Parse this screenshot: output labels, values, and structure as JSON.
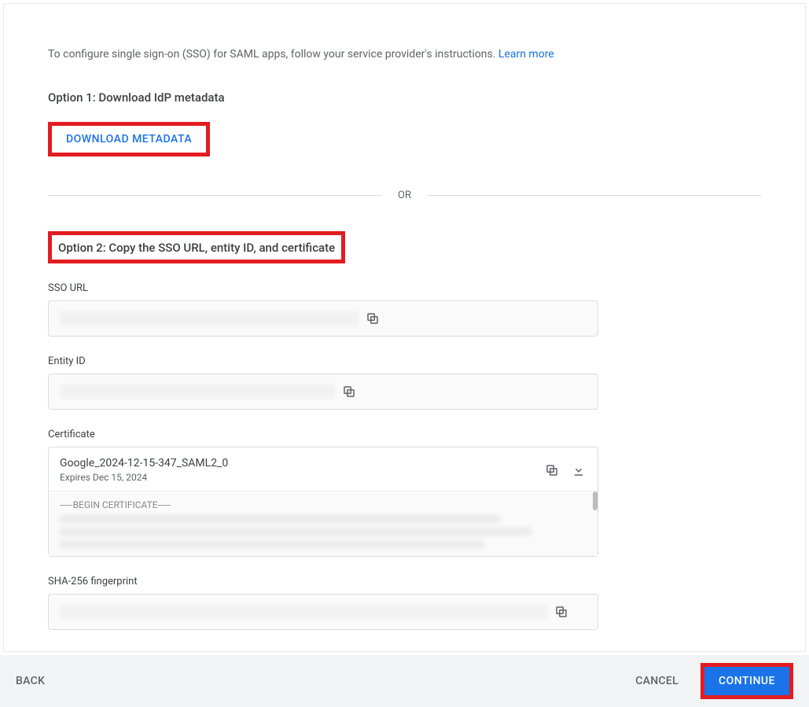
{
  "instr_text": "To configure single sign-on (SSO) for SAML apps, follow your service provider's instructions. ",
  "instr_link": "Learn more",
  "option1_title": "Option 1: Download IdP metadata",
  "download_label": "DOWNLOAD METADATA",
  "or_label": "OR",
  "option2_title": "Option 2: Copy the SSO URL, entity ID, and certificate",
  "sso_label": "SSO URL",
  "entity_label": "Entity ID",
  "cert_label": "Certificate",
  "cert_name": "Google_2024-12-15-347_SAML2_0",
  "cert_expires": "Expires Dec 15, 2024",
  "cert_begin": "-----BEGIN CERTIFICATE-----",
  "sha_label": "SHA-256 fingerprint",
  "footer": {
    "back": "BACK",
    "cancel": "CANCEL",
    "continue": "CONTINUE"
  }
}
